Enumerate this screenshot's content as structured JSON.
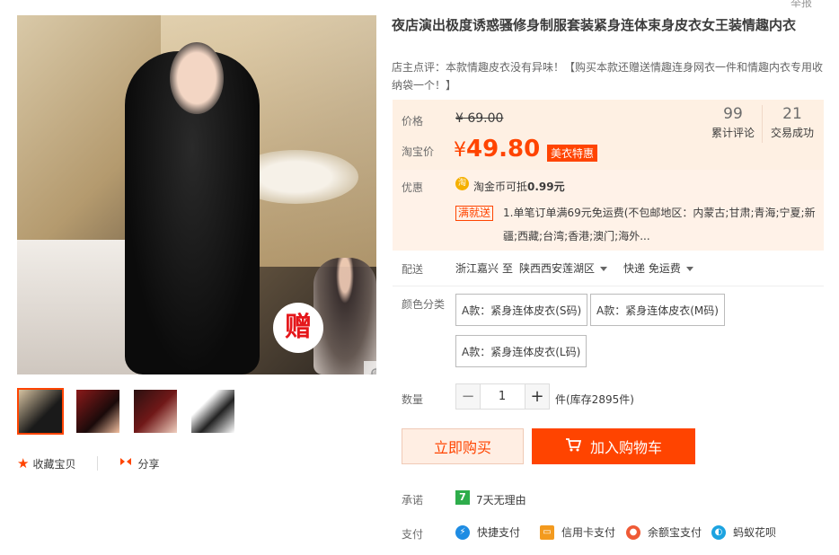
{
  "header": {
    "top_cut": "举报"
  },
  "product": {
    "title": "夜店演出极度诱惑骚修身制服套装紧身连体束身皮衣女王装情趣内衣",
    "subtitle": "店主点评：本款情趣皮衣没有异味！【购买本款还赠送情趣连身网衣一件和情趣内衣专用收纳袋一个！】",
    "gift_badge": "赠"
  },
  "price_box": {
    "price_label": "价格",
    "original_price": "¥ 69.00",
    "taobao_label": "淘宝价",
    "currency": "¥",
    "price": "49.80",
    "promo_tag": "美衣特惠",
    "reviews_count": "99",
    "reviews_label": "累计评论",
    "deals_count": "21",
    "deals_label": "交易成功",
    "discount_label": "优惠",
    "coin_icon": "淘",
    "coin_text_prefix": "淘金币可抵",
    "coin_amount": "0.99元",
    "man_tag": "满就送",
    "man_text": "1.单笔订单满69元免运费(不包邮地区：内蒙古;甘肃;青海;宁夏;新疆;西藏;台湾;香港;澳门;海外..."
  },
  "shipping": {
    "label": "配送",
    "from": "浙江嘉兴",
    "to_word": "至",
    "to": "陕西西安莲湖区",
    "method": "快递 免运费"
  },
  "sku": {
    "label": "颜色分类",
    "options": [
      "A款：紧身连体皮衣(S码)",
      "A款：紧身连体皮衣(M码)",
      "A款：紧身连体皮衣(L码)"
    ]
  },
  "quantity": {
    "label": "数量",
    "value": "1",
    "minus": "−",
    "plus": "+",
    "stock": "件(库存2895件)"
  },
  "buttons": {
    "buy_now": "立即购买",
    "add_cart": "加入购物车"
  },
  "promise": {
    "label": "承诺",
    "icon_text": "7",
    "text": "7天无理由"
  },
  "payment": {
    "label": "支付",
    "methods": [
      "快捷支付",
      "信用卡支付",
      "余额宝支付",
      "蚂蚁花呗"
    ]
  },
  "actions": {
    "favorite": "收藏宝贝",
    "share": "分享"
  },
  "colors": {
    "accent": "#ff4400",
    "price": "#ff4400",
    "price_bg": "#fef0e3"
  }
}
